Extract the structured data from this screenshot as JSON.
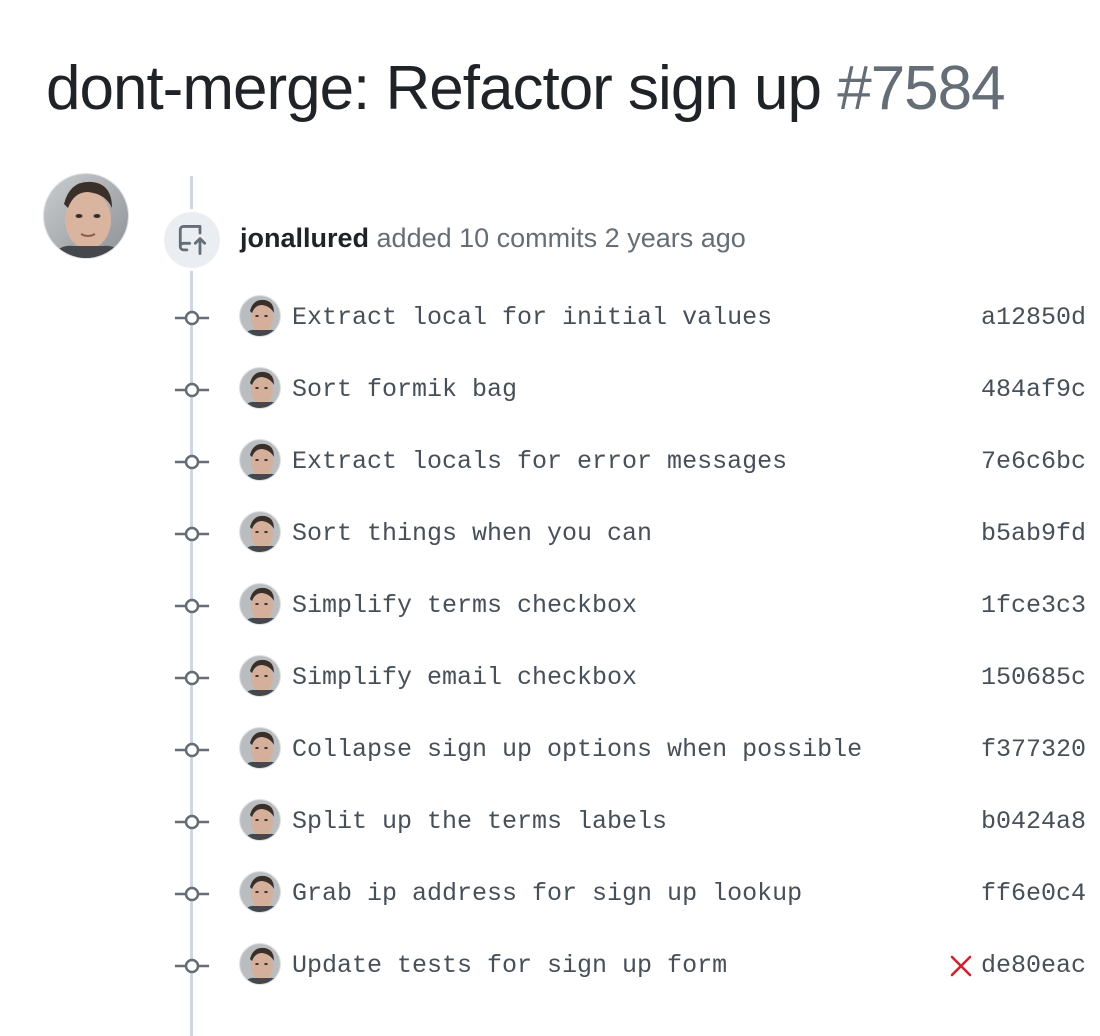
{
  "pull_request": {
    "title": "dont-merge: Refactor sign up",
    "number": "#7584"
  },
  "event": {
    "author": "jonallured",
    "action": "added 10 commits",
    "time": "2 years ago",
    "icon": "repo-push-icon"
  },
  "commits": [
    {
      "message": "Extract local for initial values",
      "sha": "a12850d",
      "status": ""
    },
    {
      "message": "Sort formik bag",
      "sha": "484af9c",
      "status": ""
    },
    {
      "message": "Extract locals for error messages",
      "sha": "7e6c6bc",
      "status": ""
    },
    {
      "message": "Sort things when you can",
      "sha": "b5ab9fd",
      "status": ""
    },
    {
      "message": "Simplify terms checkbox",
      "sha": "1fce3c3",
      "status": ""
    },
    {
      "message": "Simplify email checkbox",
      "sha": "150685c",
      "status": ""
    },
    {
      "message": "Collapse sign up options when possible",
      "sha": "f377320",
      "status": ""
    },
    {
      "message": "Split up the terms labels",
      "sha": "b0424a8",
      "status": ""
    },
    {
      "message": "Grab ip address for sign up lookup",
      "sha": "ff6e0c4",
      "status": ""
    },
    {
      "message": "Update tests for sign up form",
      "sha": "de80eac",
      "status": "failure"
    }
  ],
  "colors": {
    "failure": "#cf222e",
    "timeline": "#d0d7de",
    "node": "#656d76",
    "badge_bg": "#eaeef2"
  }
}
